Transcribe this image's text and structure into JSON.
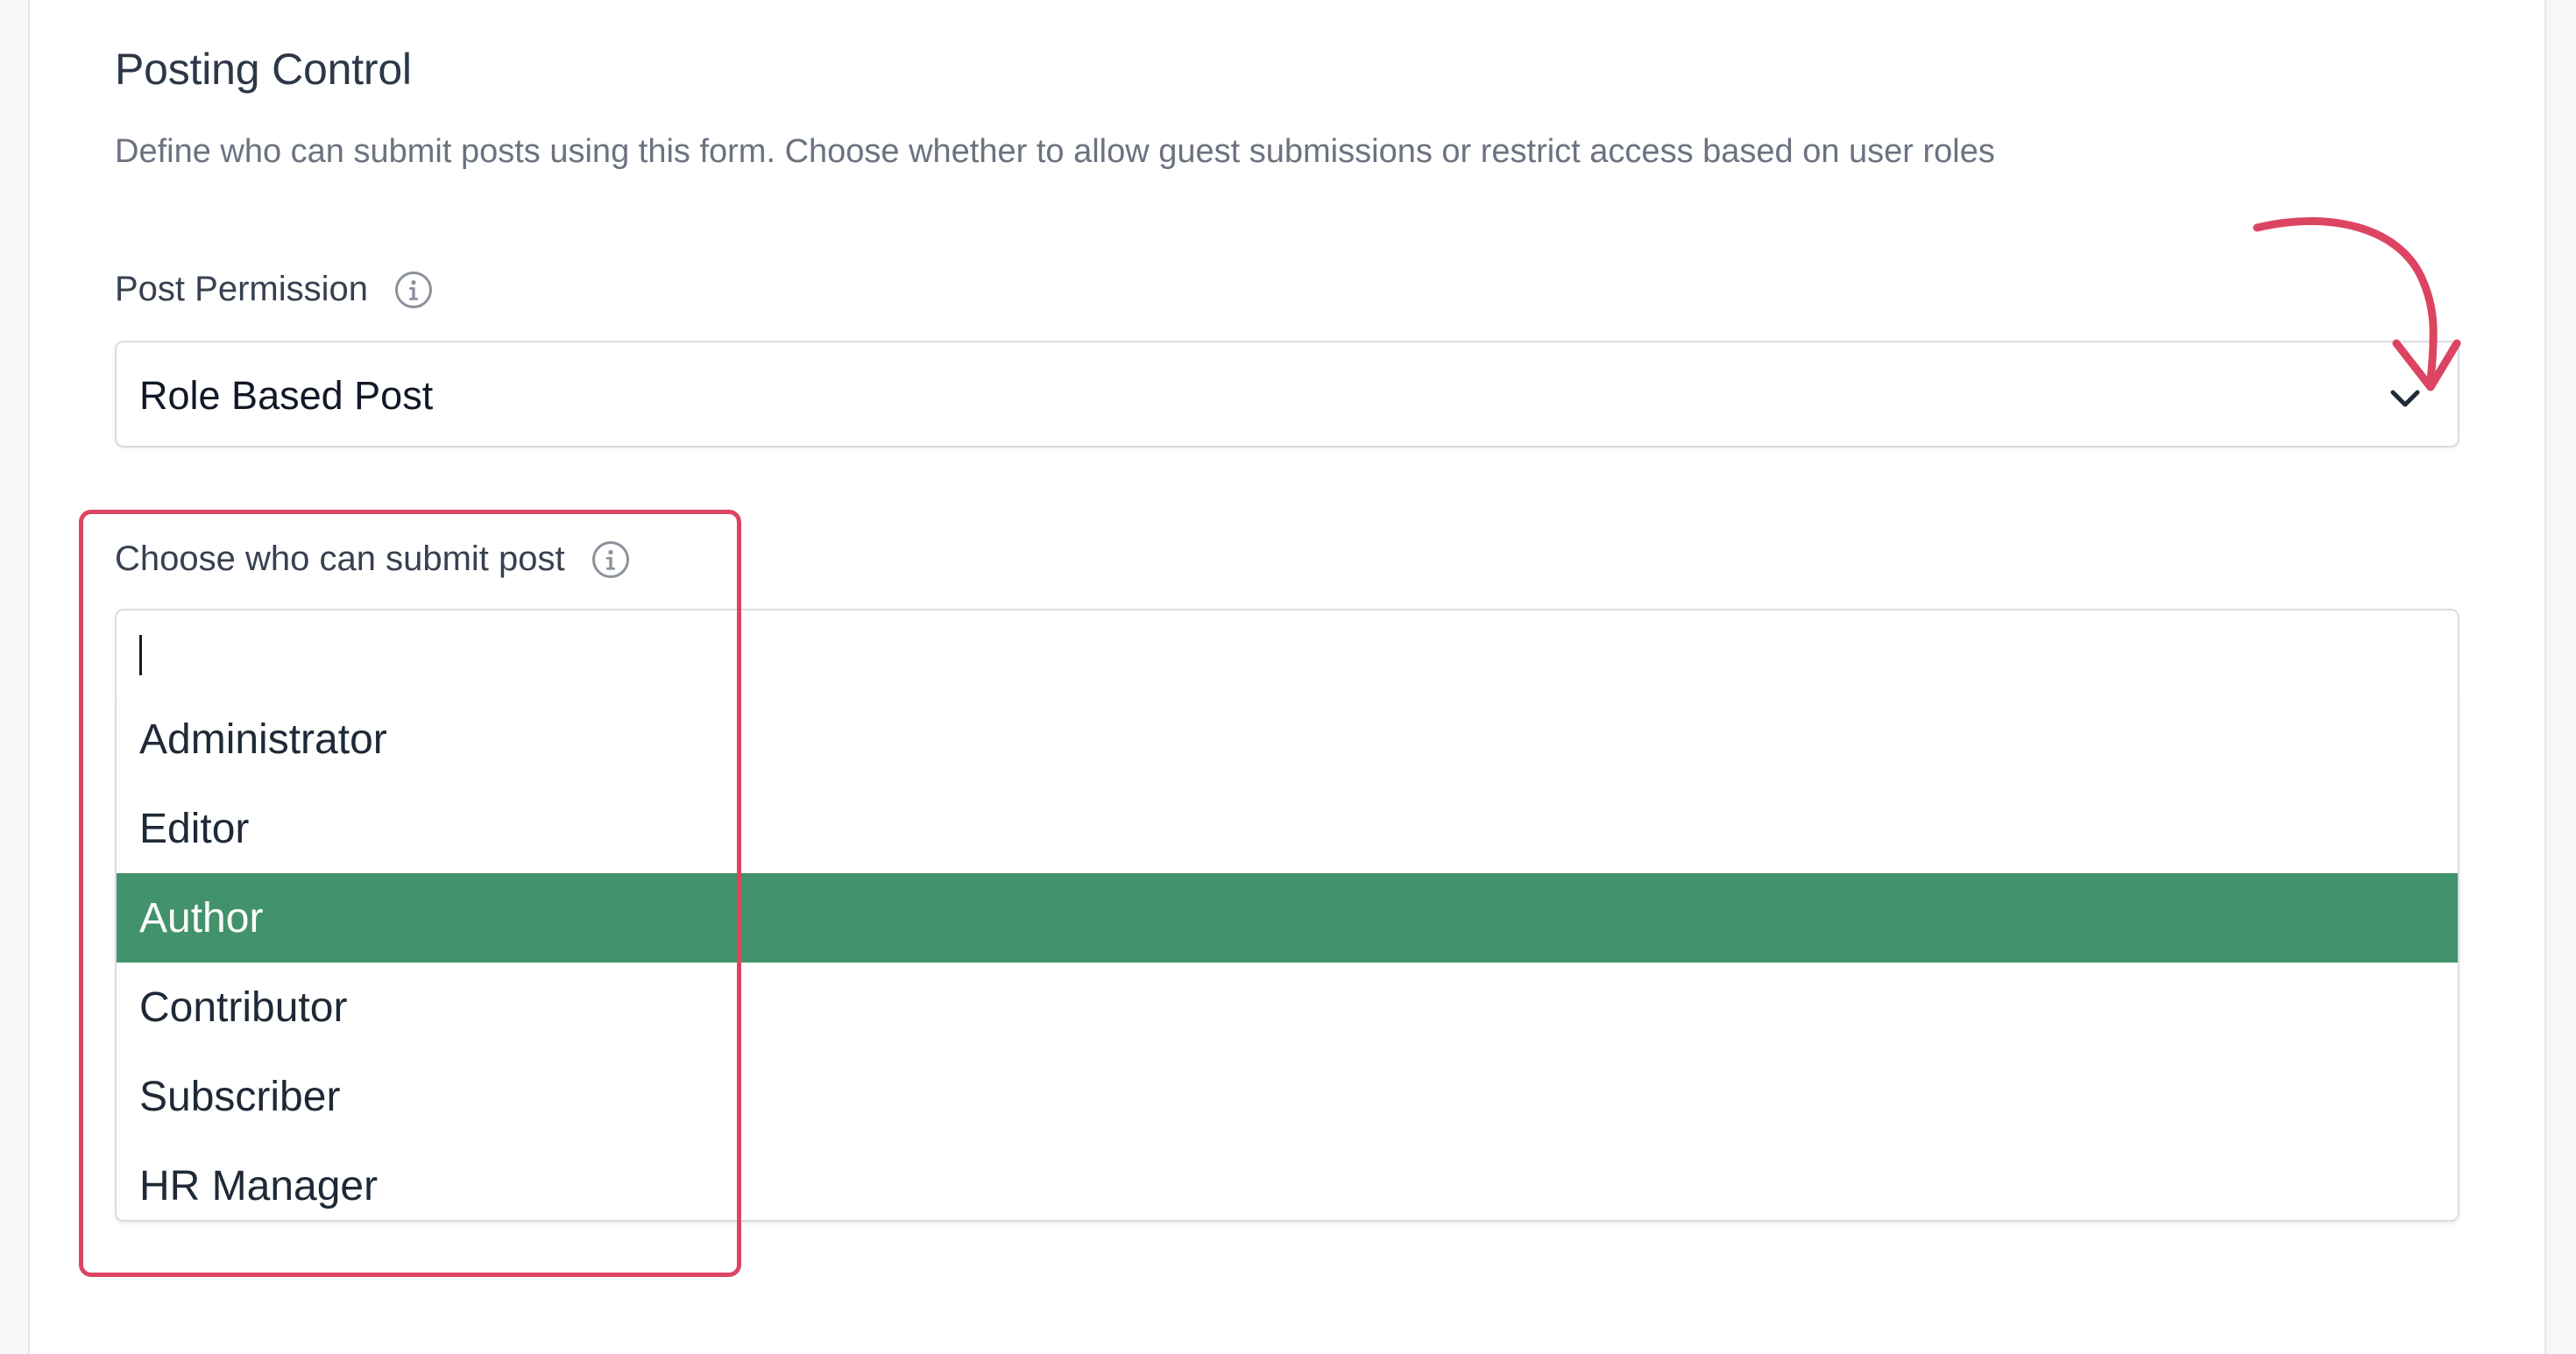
{
  "section": {
    "title": "Posting Control",
    "description": "Define who can submit posts using this form. Choose whether to allow guest submissions or restrict access based on user roles"
  },
  "post_permission": {
    "label": "Post Permission",
    "selected_value": "Role Based Post",
    "info_icon": "info-icon",
    "dropdown_icon": "chevron-down-icon"
  },
  "submit_roles": {
    "label": "Choose who can submit post",
    "info_icon": "info-icon",
    "search_value": "",
    "options": [
      {
        "label": "Administrator",
        "selected": false
      },
      {
        "label": "Editor",
        "selected": false
      },
      {
        "label": "Author",
        "selected": true
      },
      {
        "label": "Contributor",
        "selected": false
      },
      {
        "label": "Subscriber",
        "selected": false
      },
      {
        "label": "HR Manager",
        "selected": false
      }
    ]
  },
  "annotation": {
    "highlight_color": "#dc4561",
    "arrow_icon": "curved-arrow-icon",
    "option_highlight_color": "#42926b"
  }
}
